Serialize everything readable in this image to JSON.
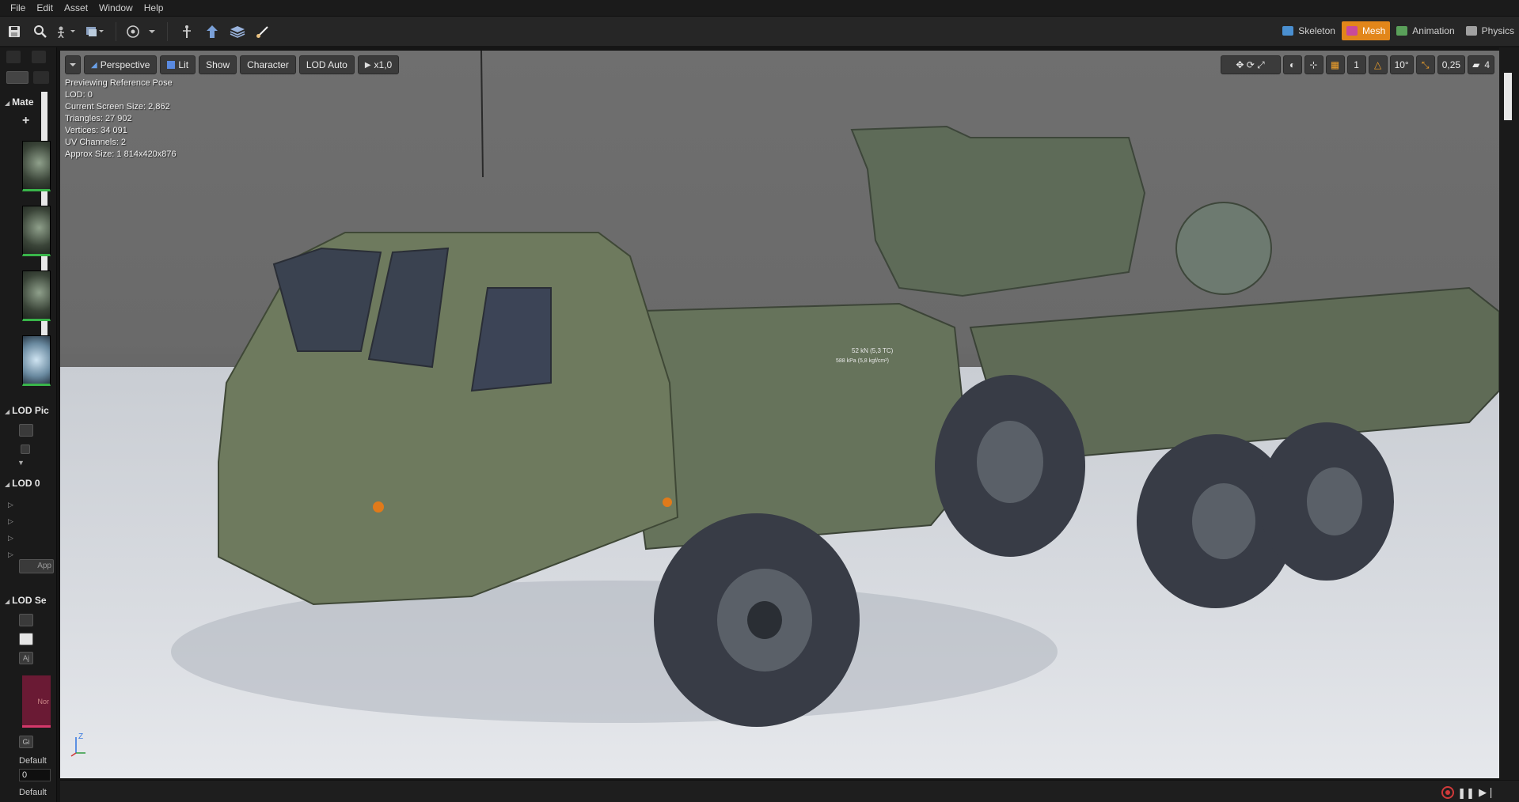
{
  "menu": {
    "items": [
      "File",
      "Edit",
      "Asset",
      "Window",
      "Help"
    ]
  },
  "modes": [
    {
      "label": "Skeleton",
      "active": false,
      "color": "#4a8fd0"
    },
    {
      "label": "Mesh",
      "active": true,
      "color": "#c84a9a"
    },
    {
      "label": "Animation",
      "active": false,
      "color": "#5aa05a"
    },
    {
      "label": "Physics",
      "active": false,
      "color": "#a0a0a0"
    }
  ],
  "left_panel": {
    "materials_header": "Mate",
    "lod_picker_header": "LOD Pic",
    "lod0_header": "LOD 0",
    "lod_settings_header": "LOD Se",
    "apply_button": "App",
    "swatch_label": "Nor",
    "g_button": "Gi",
    "default_label_1": "Default",
    "default_value": "0",
    "default_label_2": "Default",
    "aj_button": "Aj"
  },
  "viewport": {
    "toolbar": {
      "perspective": "Perspective",
      "lit": "Lit",
      "show": "Show",
      "character": "Character",
      "lod": "LOD Auto",
      "speed": "x1,0"
    },
    "stats": [
      "Previewing Reference Pose",
      "LOD: 0",
      "Current Screen Size: 2,862",
      "Triangles: 27 902",
      "Vertices: 34 091",
      "UV Channels: 2",
      "Approx Size: 1 814x420x876"
    ],
    "right_tools": {
      "grid_value": "1",
      "angle_value": "10°",
      "scale_value": "0,25",
      "camera_speed": "4"
    },
    "axis": {
      "z": "Z"
    },
    "truck_decal_line1": "52 kN (5,3 TC)",
    "truck_decal_line2": "588 kPa (5,8 kgf/cm²)"
  },
  "colors": {
    "accent": "#e2861a",
    "body": "#6e7a5e",
    "tire": "#3b3e48"
  }
}
